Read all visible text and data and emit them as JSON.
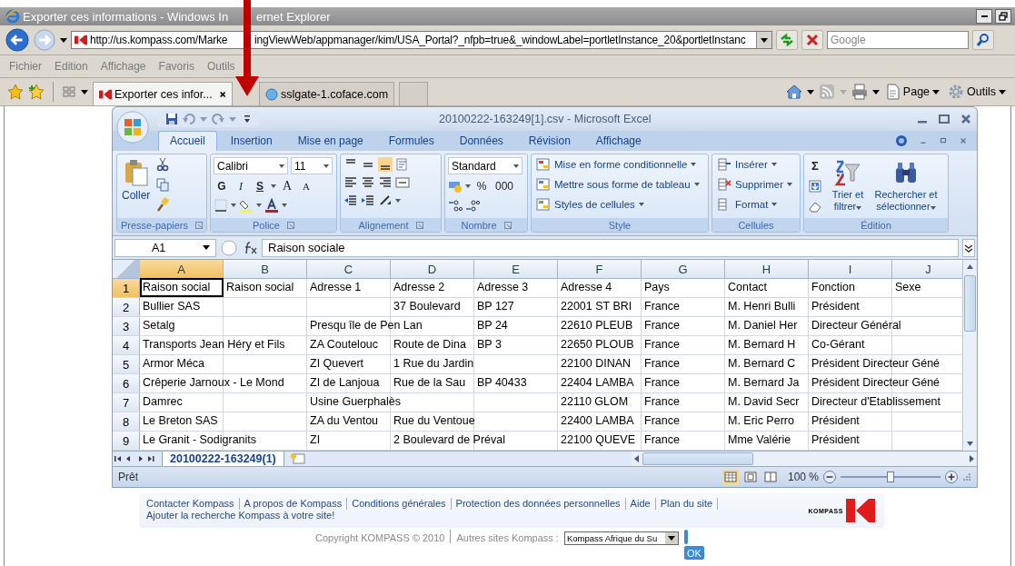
{
  "browser": {
    "title": [
      "Exporter ces informations - Windows In",
      "ernet Explorer"
    ],
    "address": [
      "http://us.kompass.com/Marke",
      "ingViewWeb/appmanager/kim/USA_Portal?_nfpb=true&_windowLabel=portletInstance_20&portletInstanc"
    ],
    "search_placeholder": "Google",
    "menu": [
      "Fichier",
      "Edition",
      "Affichage",
      "Favoris",
      "Outils"
    ],
    "tabs": [
      {
        "label": "Exporter ces infor...",
        "selected": true
      },
      {
        "label": "sslgate-1.coface.com",
        "selected": false
      }
    ],
    "commands": [
      "Page",
      "Outils"
    ]
  },
  "excel": {
    "title": "20100222-163249[1].csv - Microsoft Excel",
    "ribbon_tabs": [
      {
        "label": "Accueil",
        "selected": true
      },
      {
        "label": "Insertion",
        "selected": false
      },
      {
        "label": "Mise en page",
        "selected": false
      },
      {
        "label": "Formules",
        "selected": false
      },
      {
        "label": "Données",
        "selected": false
      },
      {
        "label": "Révision",
        "selected": false
      },
      {
        "label": "Affichage",
        "selected": false
      }
    ],
    "clipboard": {
      "paste": "Coller",
      "group": "Presse-papiers"
    },
    "font": {
      "name": "Calibri",
      "size": "11",
      "bold": "G",
      "italic": "I",
      "underline": "S",
      "grow": "A",
      "shrink": "A",
      "group": "Police"
    },
    "alignment": {
      "group": "Alignement"
    },
    "number": {
      "format": "Standard",
      "percent": "%",
      "thousands": "000",
      "group": "Nombre"
    },
    "styles": {
      "items": [
        "Mise en forme conditionnelle",
        "Mettre sous forme de tableau",
        "Styles de cellules"
      ],
      "group": "Style"
    },
    "cells": {
      "items": [
        "Insérer",
        "Supprimer",
        "Format"
      ],
      "group": "Cellules"
    },
    "editing": {
      "sum": "Σ",
      "sort": "Trier et filtrer",
      "find": "Rechercher et sélectionner",
      "group": "Édition"
    },
    "name_box": "A1",
    "formula": "Raison sociale",
    "columns": [
      {
        "label": "A",
        "selected": true
      },
      {
        "label": "B",
        "selected": false
      },
      {
        "label": "C",
        "selected": false
      },
      {
        "label": "D",
        "selected": false
      },
      {
        "label": "E",
        "selected": false
      },
      {
        "label": "F",
        "selected": false
      },
      {
        "label": "G",
        "selected": false
      },
      {
        "label": "H",
        "selected": false
      },
      {
        "label": "I",
        "selected": false
      },
      {
        "label": "J",
        "selected": false
      }
    ],
    "rows": [
      {
        "number": "1",
        "selected": true,
        "cells": [
          "Raison social",
          "Raison social",
          "Adresse 1",
          "Adresse 2",
          "Adresse 3",
          "Adresse 4",
          "Pays",
          "Contact",
          "Fonction",
          "Sexe"
        ]
      },
      {
        "number": "2",
        "selected": false,
        "cells": [
          "Bullier SAS",
          null,
          null,
          "37 Boulevard",
          "BP 127",
          "22001 ST BRI",
          "France",
          "M. Henri Bulli",
          "Président",
          null
        ]
      },
      {
        "number": "3",
        "selected": false,
        "cells": [
          "Setalg",
          null,
          "Presqu île de Pen Lan",
          null,
          "BP 24",
          "22610 PLEUB",
          "France",
          "M. Daniel Her",
          "Directeur Général",
          null
        ]
      },
      {
        "number": "4",
        "selected": false,
        "cells": [
          "Transports Jean Héry et Fils",
          null,
          "ZA Coutelouc",
          "Route de Dina",
          "BP 3",
          "22650 PLOUB",
          "France",
          "M. Bernard H",
          "Co-Gérant",
          null
        ]
      },
      {
        "number": "5",
        "selected": false,
        "cells": [
          "Armor Méca",
          null,
          "ZI Quevert",
          "1 Rue du Jardin",
          null,
          "22100 DINAN",
          "France",
          "M. Bernard C",
          "Président Directeur Géné",
          null
        ]
      },
      {
        "number": "6",
        "selected": false,
        "cells": [
          "Crêperie Jarnoux - Le Mond",
          null,
          "ZI de Lanjoua",
          "Rue de la Sau",
          "BP 40433",
          "22404 LAMBA",
          "France",
          "M. Bernard Ja",
          "Président Directeur Géné",
          null
        ]
      },
      {
        "number": "7",
        "selected": false,
        "cells": [
          "Damrec",
          null,
          "Usine Guerphalès",
          null,
          null,
          "22110 GLOM",
          "France",
          "M. David Secr",
          "Directeur d'Etablissement",
          null
        ]
      },
      {
        "number": "8",
        "selected": false,
        "cells": [
          "Le Breton SAS",
          null,
          "ZA du Ventou",
          "Rue du Ventoue",
          null,
          "22400 LAMBA",
          "France",
          "M. Eric Perro",
          "Président",
          null
        ]
      },
      {
        "number": "9",
        "selected": false,
        "cells": [
          "Le Granit - Sodigranits",
          null,
          "ZI",
          "2 Boulevard de Préval",
          null,
          "22100 QUEVE",
          "France",
          "Mme Valérie",
          "Président",
          null
        ]
      }
    ],
    "sheets": [
      {
        "label": "20100222-163249(1)",
        "selected": true
      }
    ],
    "status": "Prêt",
    "zoom": "100 %",
    "zoom_slider": {
      "level": 0.5
    }
  },
  "footer": {
    "links": [
      "Contacter Kompass",
      "A propos de Kompass",
      "Conditions générales",
      "Protection des données personnelles",
      "Aide",
      "Plan du site",
      "Ajouter la recherche Kompass à votre site!"
    ],
    "logo_text": "KOMPASS",
    "copyright": "Copyright KOMPASS © 2010",
    "other_sites": "Autres sites Kompass :",
    "site_select": "Kompass Afrique du Su",
    "ok": "OK"
  }
}
